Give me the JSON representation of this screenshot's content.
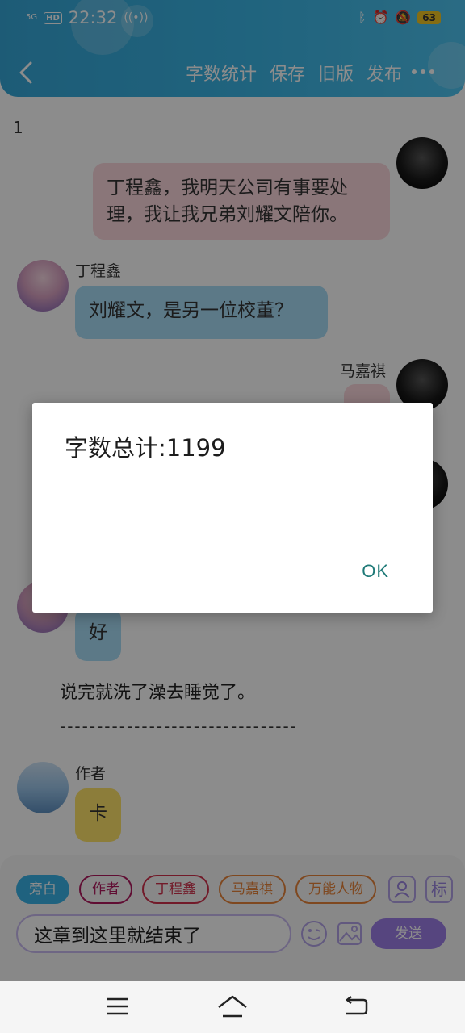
{
  "status_bar": {
    "network": "5G",
    "hd": "HD",
    "time": "22:32",
    "battery": "63"
  },
  "header": {
    "actions": [
      "字数统计",
      "保存",
      "旧版",
      "发布"
    ]
  },
  "chat": {
    "page_number": "1",
    "messages": [
      {
        "speaker": "",
        "side": "right",
        "text_line1": "丁程鑫，我明天公司有事要处",
        "text_line2": "理，我让我兄弟刘耀文陪你。"
      },
      {
        "speaker": "丁程鑫",
        "side": "left",
        "text": "刘耀文，是另一位校董？"
      },
      {
        "speaker": "马嘉祺",
        "side": "right",
        "text": ""
      },
      {
        "speaker": "",
        "side": "left",
        "text": "好"
      }
    ],
    "narration": "说完就洗了澡去睡觉了。",
    "divider": "--------------------------------",
    "author_name": "作者",
    "author_message": "卡"
  },
  "composer": {
    "roles": [
      "旁白",
      "作者",
      "丁程鑫",
      "马嘉祺",
      "万能人物"
    ],
    "tag_button": "标",
    "input_value": "这章到这里就结束了",
    "send_label": "发送"
  },
  "dialog": {
    "message": "字数总计:1199",
    "ok_label": "OK"
  },
  "colors": {
    "header": "#3bb6e6",
    "accent_purple": "#9d7ee8",
    "dialog_ok": "#1f7a78"
  }
}
